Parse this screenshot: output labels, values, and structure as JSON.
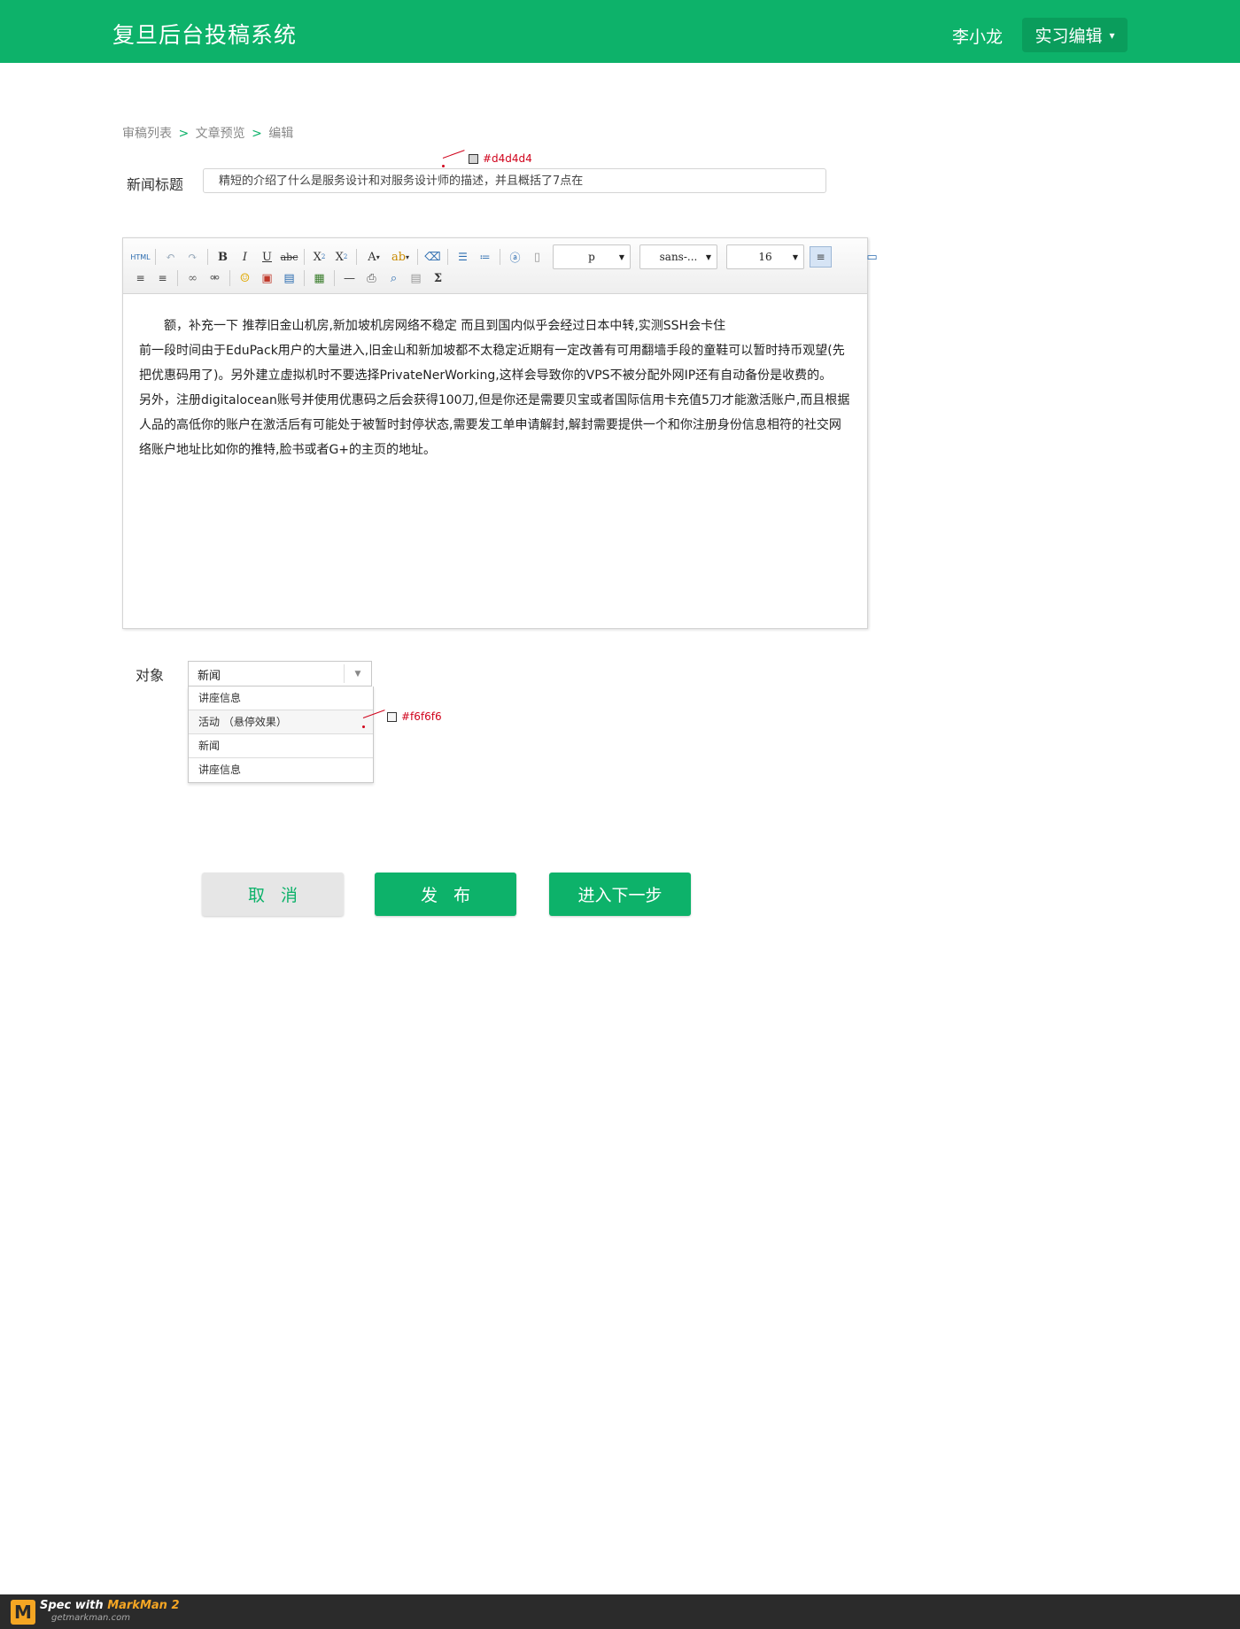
{
  "header": {
    "app_title": "复旦后台投稿系统",
    "user_name": "李小龙",
    "role_label": "实习编辑",
    "role_caret": "▾"
  },
  "breadcrumb": {
    "items": [
      "审稿列表",
      "文章预览",
      "编辑"
    ],
    "separator": ">"
  },
  "form": {
    "title_label": "新闻标题",
    "title_value": "精短的介绍了什么是服务设计和对服务设计师的描述，并且概括了7点在",
    "target_label": "对象"
  },
  "annotations": {
    "input_border_color": "#d4d4d4",
    "hover_bg_color": "#f6f6f6"
  },
  "toolbar": {
    "paragraph_select": "p",
    "font_select": "sans-...",
    "size_select": "16",
    "row1_icons": [
      "html-icon",
      "undo-icon",
      "redo-icon",
      "bold-icon",
      "italic-icon",
      "underline-icon",
      "strikethrough-icon",
      "superscript-icon",
      "subscript-icon",
      "font-color-icon",
      "highlight-icon",
      "eraser-icon",
      "ordered-list-icon",
      "unordered-list-icon",
      "anchor-icon",
      "page-icon",
      "align-left-icon",
      "preview-icon"
    ],
    "row2_icons": [
      "align-center-icon",
      "align-right-icon",
      "link-icon",
      "unlink-icon",
      "emoticon-icon",
      "image-icon",
      "video-icon",
      "insert-picture-icon",
      "horizontal-rule-icon",
      "print-icon",
      "search-icon",
      "paste-icon",
      "formula-icon"
    ]
  },
  "editor": {
    "paragraphs": [
      "额，补充一下 推荐旧金山机房,新加坡机房网络不稳定 而且到国内似乎会经过日本中转,实测SSH会卡住",
      "前一段时间由于EduPack用户的大量进入,旧金山和新加坡都不太稳定近期有一定改善有可用翻墙手段的童鞋可以暂时持币观望(先把优惠码用了)。另外建立虚拟机时不要选择PrivateNerWorking,这样会导致你的VPS不被分配外网IP还有自动备份是收费的。",
      "另外，注册digitalocean账号并使用优惠码之后会获得100刀,但是你还是需要贝宝或者国际信用卡充值5刀才能激活账户,而且根据人品的高低你的账户在激活后有可能处于被暂时封停状态,需要发工单申请解封,解封需要提供一个和你注册身份信息相符的社交网络账户地址比如你的推特,脸书或者G+的主页的地址。"
    ]
  },
  "target_select": {
    "selected": "新闻",
    "options": [
      "讲座信息",
      "活动 （悬停效果）",
      "新闻",
      "讲座信息"
    ]
  },
  "buttons": {
    "cancel": "取消",
    "publish": "发布",
    "next": "进入下一步"
  },
  "footer": {
    "brand_a": "Spec with ",
    "brand_b": "MarkMan 2",
    "url": "getmarkman.com",
    "logo_letter": "M"
  },
  "colors": {
    "brand_green": "#0db26a",
    "footer_bg": "#2b2b2b"
  }
}
